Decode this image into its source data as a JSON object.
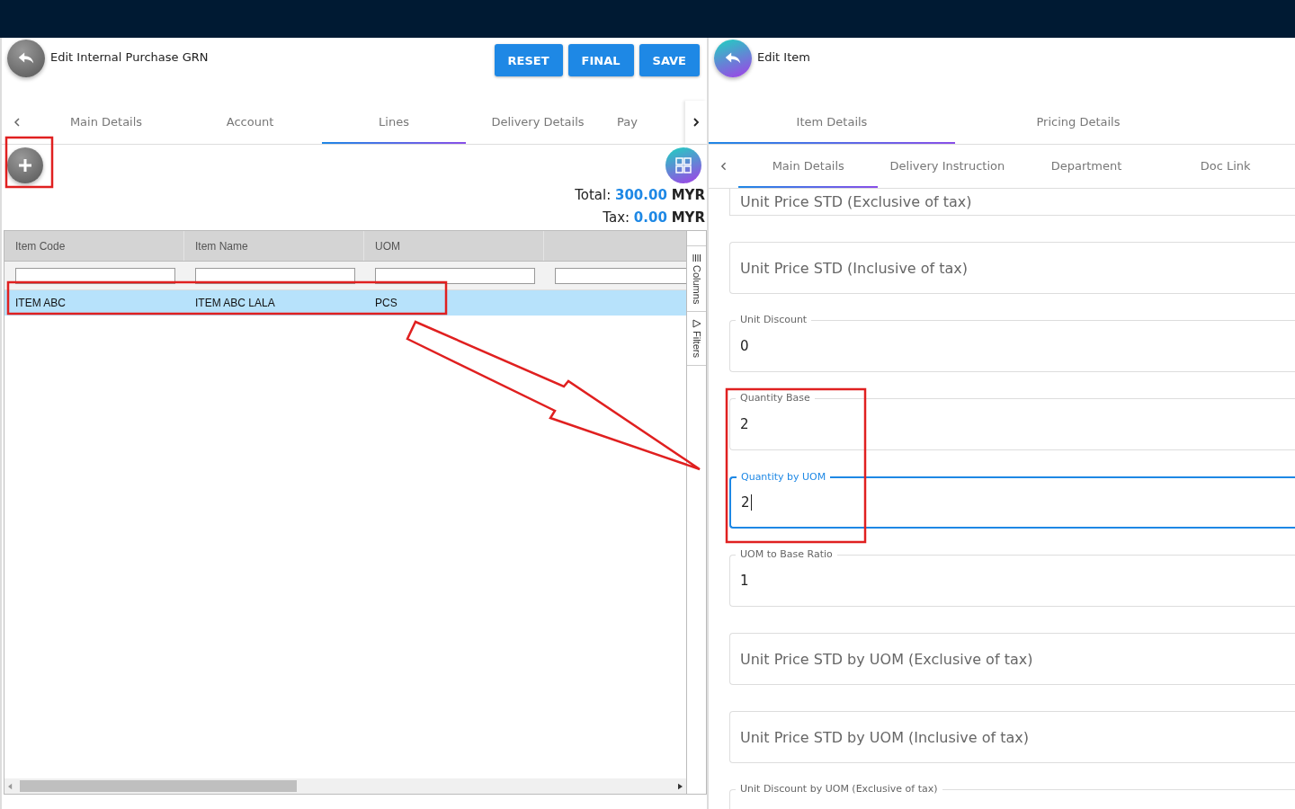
{
  "left": {
    "title": "Edit Internal Purchase GRN",
    "buttons": [
      "RESET",
      "FINAL",
      "SAVE"
    ],
    "tabs": [
      {
        "label": "Main Details",
        "selected": false
      },
      {
        "label": "Account",
        "selected": false
      },
      {
        "label": "Lines",
        "selected": true
      },
      {
        "label": "Delivery Details",
        "selected": false
      },
      {
        "label": "Pay",
        "selected": false
      }
    ],
    "total": {
      "label": "Total:",
      "amount": "300.00",
      "currency": "MYR"
    },
    "tax": {
      "label": "Tax:",
      "amount": "0.00",
      "currency": "MYR"
    },
    "table": {
      "columns": [
        "Item Code",
        "Item Name",
        "UOM"
      ],
      "rows": [
        {
          "cells": [
            "ITEM ABC",
            "ITEM ABC LALA",
            "PCS"
          ],
          "selected": true
        }
      ],
      "side_tabs": [
        "Columns",
        "Filters"
      ]
    }
  },
  "right": {
    "title": "Edit Item",
    "tabs": [
      {
        "label": "Item Details",
        "selected": true
      },
      {
        "label": "Pricing Details",
        "selected": false
      }
    ],
    "subtabs": [
      {
        "label": "Main Details",
        "selected": true
      },
      {
        "label": "Delivery Instruction",
        "selected": false
      },
      {
        "label": "Department",
        "selected": false
      },
      {
        "label": "Doc Link",
        "selected": false
      }
    ],
    "fields": [
      {
        "kind": "empty",
        "label": "Unit Price STD (Exclusive of tax)",
        "focused": false
      },
      {
        "kind": "empty",
        "label": "Unit Price STD (Inclusive of tax)",
        "focused": false
      },
      {
        "kind": "labelled",
        "label": "Unit Discount",
        "value": "0",
        "focused": false
      },
      {
        "kind": "labelled",
        "label": "Quantity Base",
        "value": "2",
        "focused": false
      },
      {
        "kind": "labelled",
        "label": "Quantity by UOM",
        "value": "2",
        "focused": true
      },
      {
        "kind": "labelled",
        "label": "UOM to Base Ratio",
        "value": "1",
        "focused": false
      },
      {
        "kind": "empty",
        "label": "Unit Price STD by UOM (Exclusive of tax)",
        "focused": false
      },
      {
        "kind": "empty",
        "label": "Unit Price STD by UOM (Inclusive of tax)",
        "focused": false
      },
      {
        "kind": "labelled",
        "label": "Unit Discount by UOM (Exclusive of tax)",
        "focused": false
      }
    ]
  }
}
